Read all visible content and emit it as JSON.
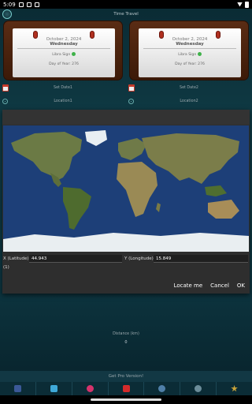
{
  "status": {
    "time": "5:09"
  },
  "app": {
    "title": "Time Travel"
  },
  "calendars": [
    {
      "date": "October 2, 2024",
      "weekday": "Wednesday",
      "sign": "Libra Sign",
      "day_of_year": "Day of Year: 276"
    },
    {
      "date": "October 2, 2024",
      "weekday": "Wednesday",
      "sign": "Libra Sign",
      "day_of_year": "Day of Year: 276"
    }
  ],
  "buttons": {
    "set_date1": "Set Date1",
    "set_date2": "Set Date2",
    "location1": "Location1",
    "location2": "Location2"
  },
  "dialog": {
    "x_label": "X (Latitude)",
    "x_value": "44.943",
    "y_label": "Y (Longitude)",
    "y_value": "15.849",
    "count": "(1)",
    "locate_label": "Locate me",
    "cancel_label": "Cancel",
    "ok_label": "OK"
  },
  "distance": {
    "label": "Distance (km)",
    "value": "0"
  },
  "pro": {
    "label": "Get Pro Version!"
  },
  "social_icons": [
    "facebook-icon",
    "twitter-icon",
    "instagram-icon",
    "youtube-icon",
    "globe-icon",
    "app-store-icon",
    "star-icon"
  ],
  "colors": {
    "accent": "#0f3a44",
    "calendar_frame": "#5a2c14",
    "dialog_bg": "#2e2e2e"
  }
}
